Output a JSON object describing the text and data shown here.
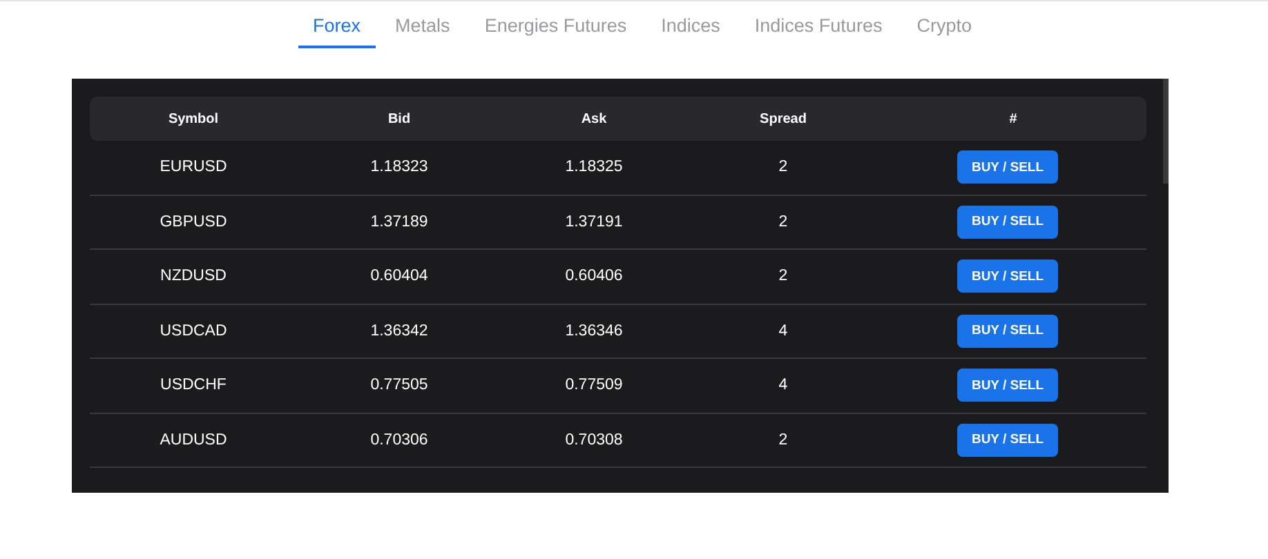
{
  "tabs": [
    {
      "label": "Forex",
      "selected": true
    },
    {
      "label": "Metals",
      "selected": false
    },
    {
      "label": "Energies Futures",
      "selected": false
    },
    {
      "label": "Indices",
      "selected": false
    },
    {
      "label": "Indices Futures",
      "selected": false
    },
    {
      "label": "Crypto",
      "selected": false
    }
  ],
  "table": {
    "columns": [
      "Symbol",
      "Bid",
      "Ask",
      "Spread",
      "#"
    ],
    "rows": [
      {
        "symbol": "EURUSD",
        "bid": "1.18323",
        "ask": "1.18325",
        "spread": "2",
        "action": "BUY / SELL"
      },
      {
        "symbol": "GBPUSD",
        "bid": "1.37189",
        "ask": "1.37191",
        "spread": "2",
        "action": "BUY / SELL"
      },
      {
        "symbol": "NZDUSD",
        "bid": "0.60404",
        "ask": "0.60406",
        "spread": "2",
        "action": "BUY / SELL"
      },
      {
        "symbol": "USDCAD",
        "bid": "1.36342",
        "ask": "1.36346",
        "spread": "4",
        "action": "BUY / SELL"
      },
      {
        "symbol": "USDCHF",
        "bid": "0.77505",
        "ask": "0.77509",
        "spread": "4",
        "action": "BUY / SELL"
      },
      {
        "symbol": "AUDUSD",
        "bid": "0.70306",
        "ask": "0.70308",
        "spread": "2",
        "action": "BUY / SELL"
      }
    ]
  }
}
